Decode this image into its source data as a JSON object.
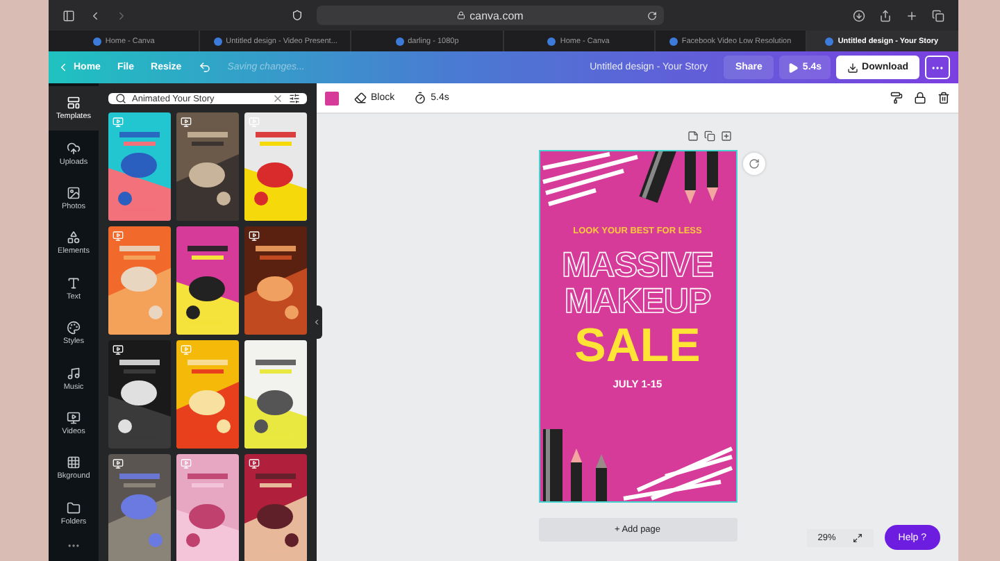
{
  "browser": {
    "url": "canva.com",
    "tabs": [
      {
        "title": "Home - Canva",
        "selected": false
      },
      {
        "title": "Untitled design - Video Present...",
        "selected": false
      },
      {
        "title": "darling - 1080p",
        "selected": false
      },
      {
        "title": "Home - Canva",
        "selected": false
      },
      {
        "title": "Facebook Video Low Resolution",
        "selected": false
      },
      {
        "title": "Untitled design - Your Story",
        "selected": true
      }
    ]
  },
  "header": {
    "home": "Home",
    "menus": [
      "File",
      "Resize"
    ],
    "status": "Saving changes...",
    "title": "Untitled design - Your Story",
    "share": "Share",
    "play": "5.4s",
    "download": "Download"
  },
  "rail": [
    {
      "label": "Templates",
      "selected": true
    },
    {
      "label": "Uploads",
      "selected": false
    },
    {
      "label": "Photos",
      "selected": false
    },
    {
      "label": "Elements",
      "selected": false
    },
    {
      "label": "Text",
      "selected": false
    },
    {
      "label": "Styles",
      "selected": false
    },
    {
      "label": "Music",
      "selected": false
    },
    {
      "label": "Videos",
      "selected": false
    },
    {
      "label": "Bkground",
      "selected": false
    },
    {
      "label": "Folders",
      "selected": false
    }
  ],
  "panel": {
    "search": {
      "value": "Animated Your Story"
    },
    "templates": [
      {
        "kind": "picture",
        "video": true
      },
      {
        "kind": "picture",
        "video": true
      },
      {
        "kind": "picture",
        "video": true
      },
      {
        "kind": "picture",
        "video": true
      },
      {
        "kind": "picture",
        "video": false
      },
      {
        "kind": "picture",
        "video": true
      },
      {
        "kind": "picture",
        "video": true
      },
      {
        "kind": "picture",
        "video": true
      },
      {
        "kind": "picture",
        "video": false
      },
      {
        "kind": "picture",
        "video": true
      },
      {
        "kind": "picture",
        "video": true
      },
      {
        "kind": "picture",
        "video": true
      }
    ]
  },
  "toolbar": {
    "color": "#d63b9a",
    "effect": "Block",
    "duration": "5.4s"
  },
  "design": {
    "tagline": "LOOK YOUR BEST FOR LESS",
    "headline": [
      "MASSIVE",
      "MAKEUP"
    ],
    "sale": "SALE",
    "dates": "JULY 1-15"
  },
  "add_page": "+ Add page",
  "zoom": "29%",
  "help": "Help ?"
}
